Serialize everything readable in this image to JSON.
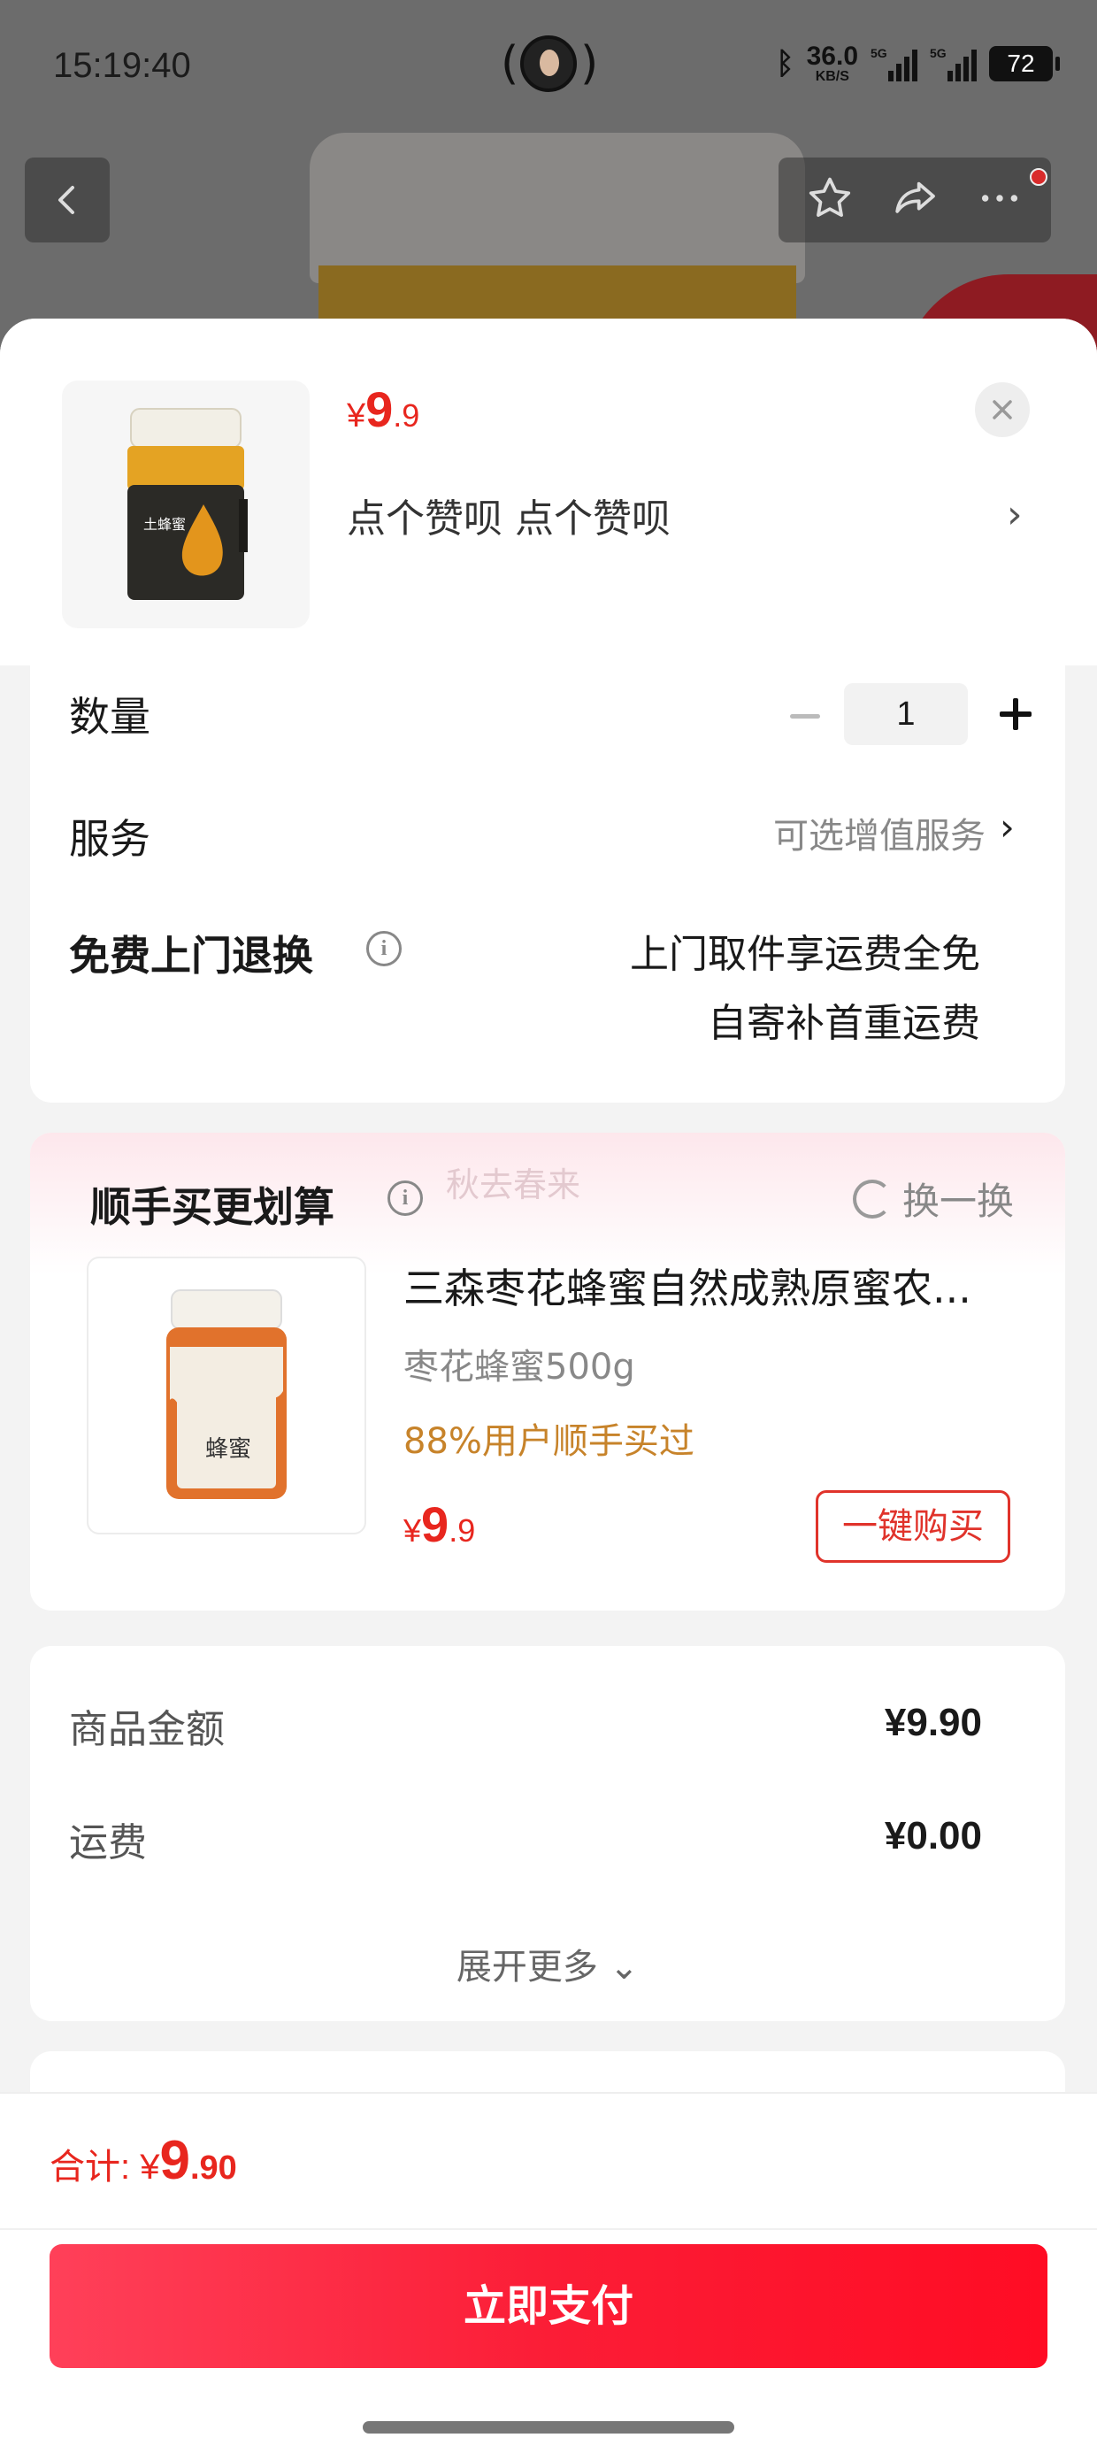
{
  "status_bar": {
    "time": "15:19:40",
    "net_speed_value": "36.0",
    "net_speed_unit": "KB/S",
    "signal_label_1": "5G",
    "signal_label_2": "5G",
    "battery": "72"
  },
  "product": {
    "price_symbol": "¥",
    "price_int": "9",
    "price_dec": ".9",
    "spec": "点个赞呗  点个赞呗",
    "jar_label": "土蜂蜜"
  },
  "quantity": {
    "label": "数量",
    "value": "1"
  },
  "service": {
    "label": "服务",
    "hint": "可选增值服务"
  },
  "free_return": {
    "label": "免费上门退换",
    "line1": "上门取件享运费全免",
    "line2": "自寄补首重运费"
  },
  "upsell": {
    "title": "顺手买更划算",
    "watermark": "秋去春来",
    "swap_label": "换一换",
    "name": "三森枣花蜂蜜自然成熟原蜜农...",
    "spec": "枣花蜂蜜500g",
    "tag": "88%用户顺手买过",
    "price_symbol": "¥",
    "price_int": "9",
    "price_dec": ".9",
    "buy_label": "一键购买",
    "jar_label": "蜂蜜"
  },
  "amounts": {
    "goods_label": "商品金额",
    "goods_value": "¥9.90",
    "shipping_label": "运费",
    "shipping_value": "¥0.00",
    "expand_label": "展开更多 ⌄"
  },
  "bottom": {
    "total_label": "合计: ¥",
    "total_int": "9",
    "total_dec": ".90",
    "pay_label": "立即支付"
  },
  "colors": {
    "accent": "#e8261e",
    "pay_gradient_start": "#ff4059",
    "pay_gradient_end": "#ff0c24",
    "tag_orange": "#c7832a"
  },
  "icons": [
    "back-icon",
    "star-icon",
    "share-icon",
    "more-icon",
    "close-icon",
    "chevron-right-icon",
    "info-icon",
    "refresh-icon",
    "minus-icon",
    "plus-icon",
    "bluetooth-icon",
    "signal-icon",
    "battery-icon"
  ]
}
